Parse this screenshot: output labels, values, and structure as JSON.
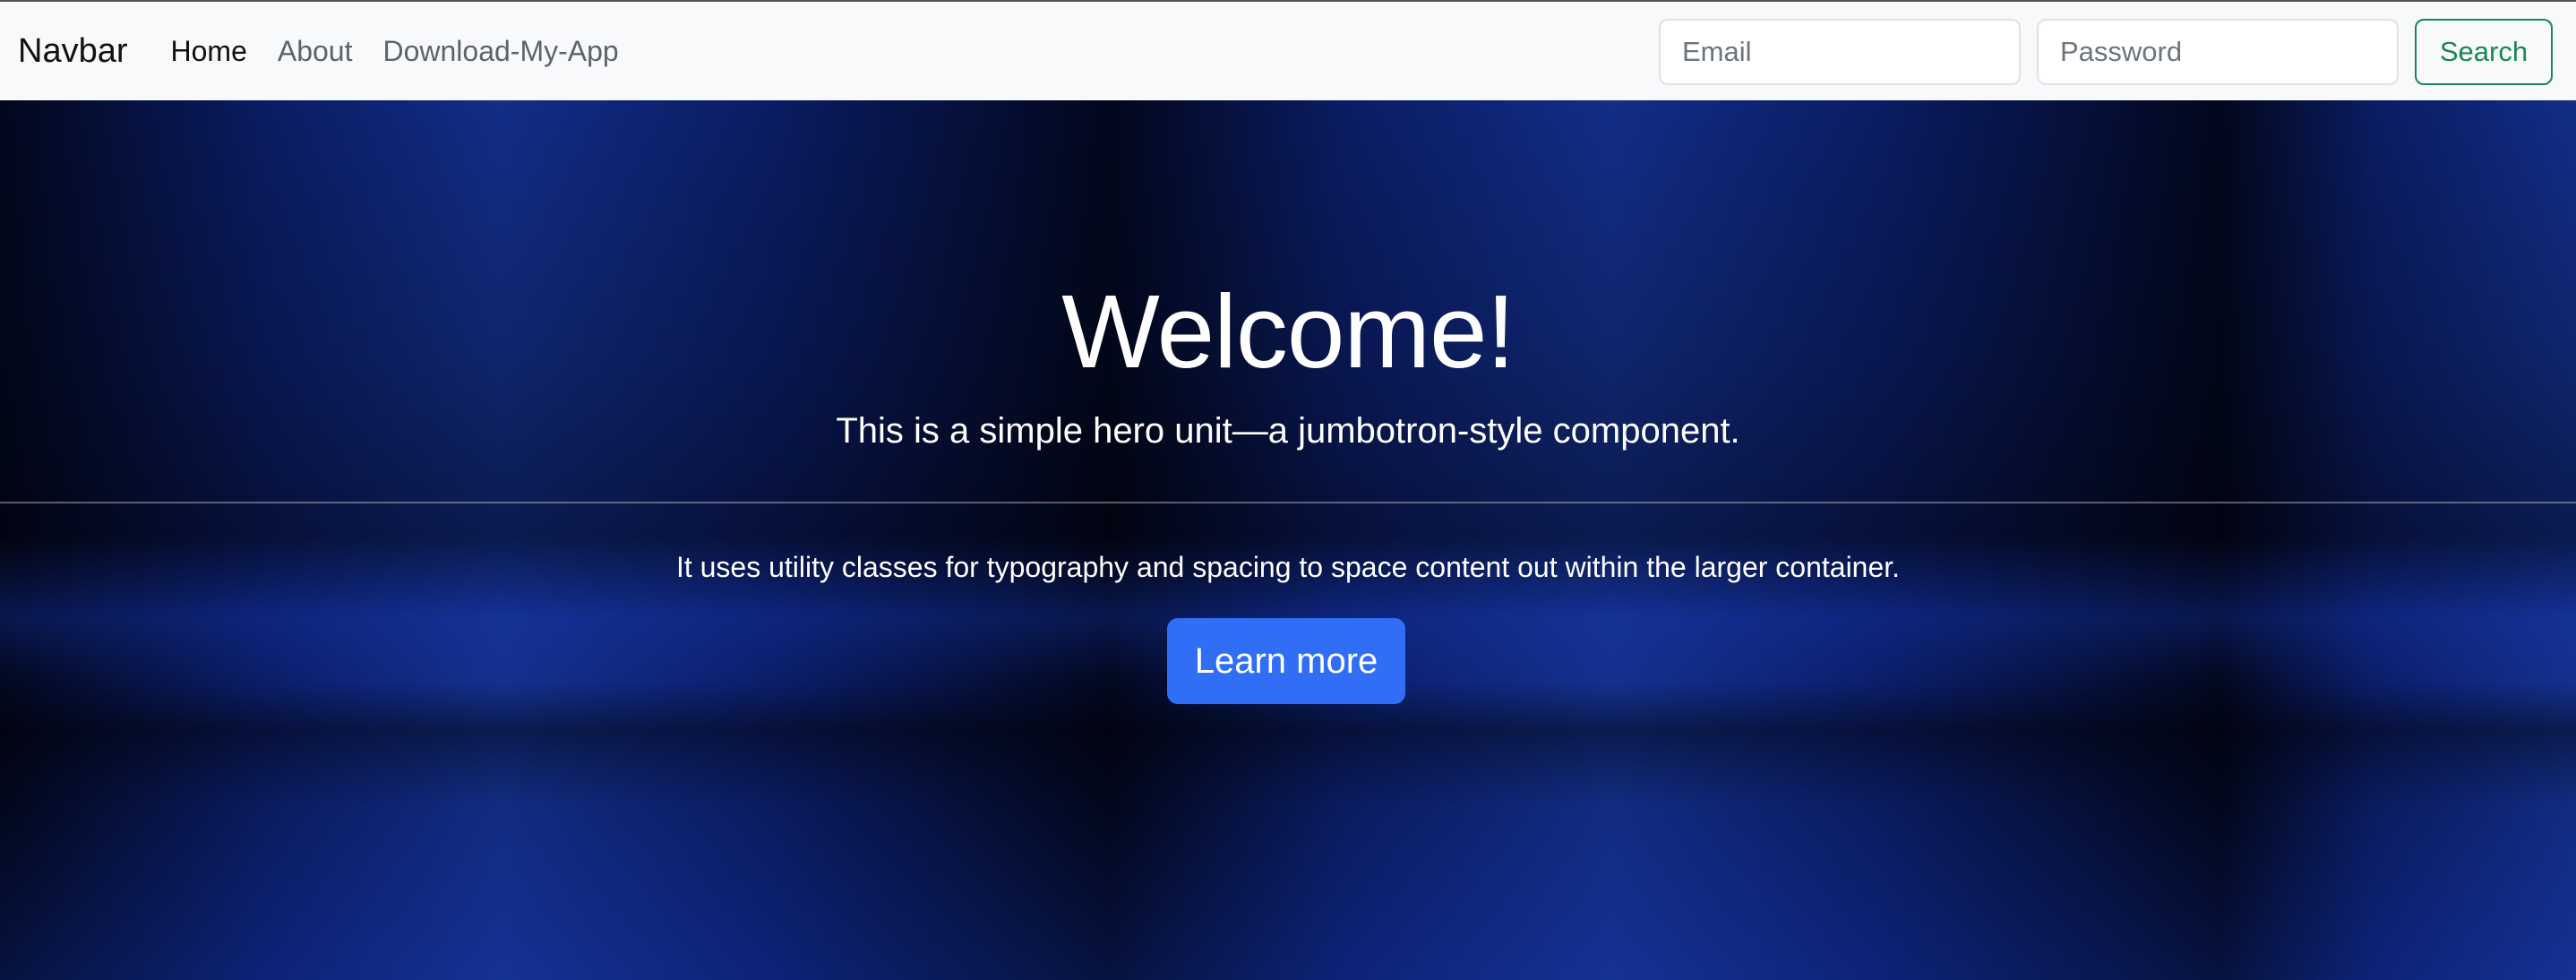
{
  "navbar": {
    "brand": "Navbar",
    "links": [
      {
        "label": "Home",
        "active": true
      },
      {
        "label": "About",
        "active": false
      },
      {
        "label": "Download-My-App",
        "active": false
      }
    ],
    "email_placeholder": "Email",
    "password_placeholder": "Password",
    "search_label": "Search"
  },
  "hero": {
    "title": "Welcome!",
    "lead": "This is a simple hero unit—a jumbotron-style component.",
    "body": "It uses utility classes for typography and spacing to space content out within the larger container.",
    "button_label": "Learn more"
  },
  "colors": {
    "navbar_bg": "#f8f9fa",
    "search_accent": "#198754",
    "primary_button": "#2f6ef5",
    "hero_background": "#0a1a5c"
  }
}
